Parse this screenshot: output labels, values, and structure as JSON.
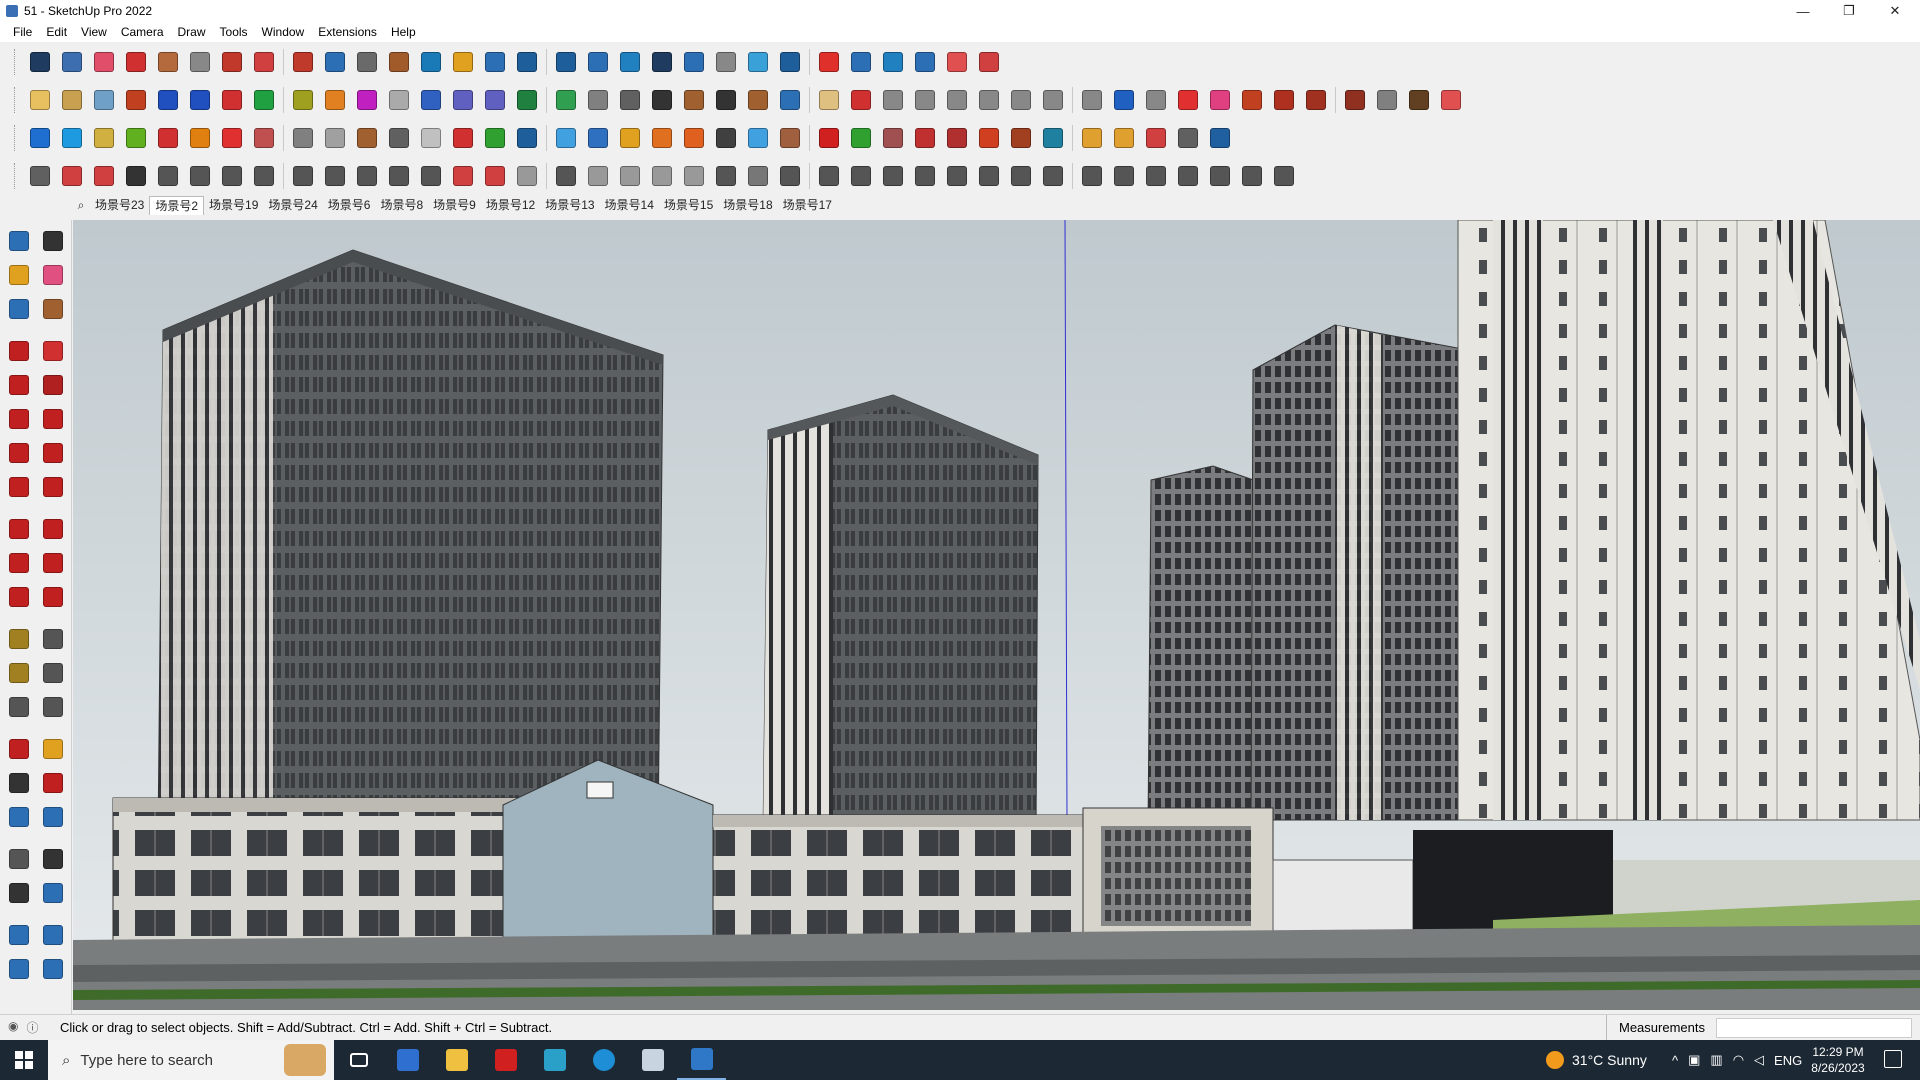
{
  "window": {
    "title": "51 - SketchUp Pro 2022",
    "minimize": "—",
    "maximize": "❐",
    "close": "✕"
  },
  "menu": [
    "File",
    "Edit",
    "View",
    "Camera",
    "Draw",
    "Tools",
    "Window",
    "Extensions",
    "Help"
  ],
  "toolbars": {
    "row1": [
      "#1f3b5f",
      "#3d6fb0",
      "#e04e6a",
      "#d03030",
      "#b56a3e",
      "#888",
      "#c0392b",
      "#d04040",
      "#c03a2b",
      "#2d6fb5",
      "#6a6a6a",
      "#a15a2a",
      "#1a7ab8",
      "#e0a020",
      "#2d6fb5",
      "#1e5e9a",
      "#1e5e9a",
      "#2d6fb5",
      "#2080c0",
      "#1f3b5f",
      "#2d6fb5",
      "#888",
      "#3aa0d8",
      "#1e5e9a",
      "#e0302b",
      "#2d6fb5",
      "#2080c0",
      "#2d6fb5",
      "#e05050",
      "#d04040"
    ],
    "row2": [
      "#e8c060",
      "#c8a050",
      "#6ea0c8",
      "#c04020",
      "#2050c0",
      "#2050c0",
      "#d03030",
      "#20a040",
      "#a0a020",
      "#e08020",
      "#c020c0",
      "#aaa",
      "#3060c0",
      "#6060c0",
      "#6060c0",
      "#208040",
      "#30a050",
      "#808080",
      "#606060",
      "#333",
      "#a06030",
      "#333",
      "#a06030",
      "#2d6fb5",
      "#e0c080",
      "#d03030",
      "#888",
      "#888",
      "#888",
      "#888",
      "#888",
      "#888",
      "#888",
      "#2060c0",
      "#888",
      "#e03030",
      "#e04080",
      "#c04020",
      "#b03020",
      "#a03020",
      "#903020",
      "#808080",
      "#604020",
      "#e05050"
    ],
    "row3": [
      "#1e6fd0",
      "#1e9be0",
      "#d0b040",
      "#60b020",
      "#d03030",
      "#e08010",
      "#e03030",
      "#c05050",
      "#808080",
      "#a0a0a0",
      "#a06030",
      "#606060",
      "#c0c0c0",
      "#d03030",
      "#30a030",
      "#1e5e9a",
      "#40a0e0",
      "#3070c0",
      "#e0a020",
      "#e07020",
      "#e06020",
      "#404040",
      "#40a0e0",
      "#a06040",
      "#d02020",
      "#30a030",
      "#a05050",
      "#c03030",
      "#b03030",
      "#d04020",
      "#a04020",
      "#2080a0",
      "#e0a030",
      "#e0a030",
      "#d04040",
      "#606060",
      "#2060a0"
    ],
    "row4": [
      "#606060",
      "#d04040",
      "#d04040",
      "#333",
      "#555",
      "#555",
      "#555",
      "#555",
      "#555",
      "#555",
      "#555",
      "#555",
      "#555",
      "#d04040",
      "#d04040",
      "#999",
      "#555",
      "#999",
      "#999",
      "#999",
      "#999",
      "#555",
      "#777",
      "#555",
      "#555",
      "#555",
      "#555",
      "#555",
      "#555",
      "#555",
      "#555",
      "#555",
      "#555",
      "#555",
      "#555",
      "#555",
      "#555",
      "#555",
      "#555"
    ]
  },
  "scenes": {
    "tabs": [
      "场景号23",
      "场景号2",
      "场景号19",
      "场景号24",
      "场景号6",
      "场景号8",
      "场景号9",
      "场景号12",
      "场景号13",
      "场景号14",
      "场景号15",
      "场景号18",
      "场景号17"
    ],
    "active": "场景号2"
  },
  "left_tools": [
    "select-icon",
    "orbit-icon",
    "paint-bucket-icon",
    "eraser-icon",
    "components-icon",
    "tape-icon",
    "pencil-icon",
    "freehand-icon",
    "rectangle-icon",
    "rotated-rect-icon",
    "circle-icon",
    "polygon-icon",
    "arc-icon",
    "arc-2pt-icon",
    "arc-3pt-icon",
    "pie-icon",
    "move-icon",
    "push-pull-icon",
    "rotate-icon",
    "follow-me-icon",
    "scale-icon",
    "offset-icon",
    "tape-measure-icon",
    "dimension-icon",
    "protractor-icon",
    "text-icon",
    "axes-icon",
    "3d-text-icon",
    "orbit-view-icon",
    "pan-icon",
    "zoom-icon",
    "zoom-window-icon",
    "zoom-extents-icon",
    "prev-view-icon",
    "position-camera-icon",
    "look-around-icon",
    "walk-icon",
    "section-plane-icon",
    "sandbox-icon",
    "sandbox-2-icon",
    "sandbox-3-icon",
    "sandbox-4-icon"
  ],
  "status": {
    "message": "Click or drag to select objects. Shift = Add/Subtract. Ctrl = Add. Shift + Ctrl = Subtract.",
    "measurements_label": "Measurements",
    "measurements_value": ""
  },
  "taskbar": {
    "search_placeholder": "Type here to search",
    "weather": "31°C  Sunny",
    "lang": "ENG",
    "time": "12:29 PM",
    "date": "8/26/2023"
  },
  "viewport": {
    "sky": "#c9d2d6",
    "ground": "#7a7d7e",
    "axis_blue": "#3030d0"
  }
}
